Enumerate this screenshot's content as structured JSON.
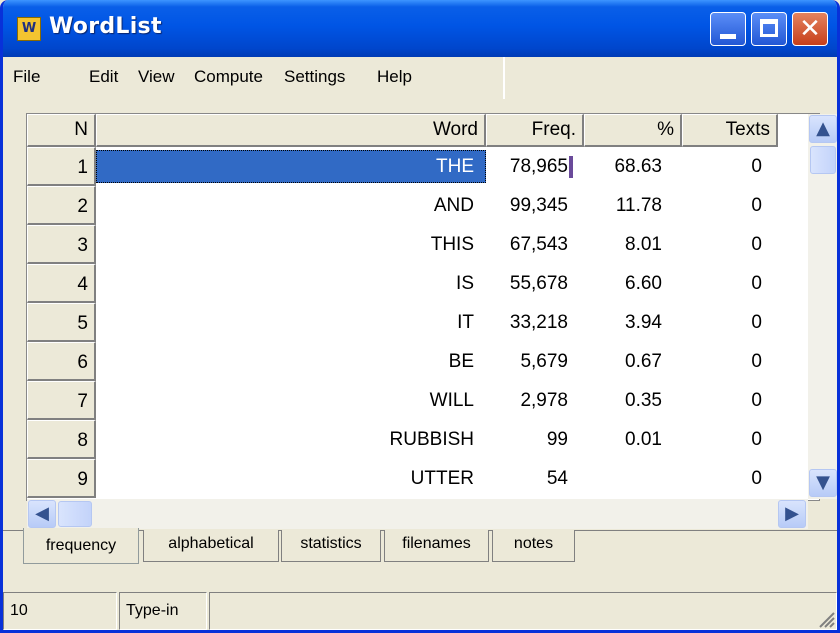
{
  "window": {
    "title": "WordList",
    "icon": "wordlist-app-icon",
    "accent": "#0055e5"
  },
  "menu": [
    "File",
    "Edit",
    "View",
    "Compute",
    "Settings",
    "Help"
  ],
  "table": {
    "columns": [
      "N",
      "Word",
      "Freq.",
      "%",
      "Texts"
    ],
    "rows": [
      {
        "n": "1",
        "word": "THE",
        "freq": "78,965",
        "pct": "68.63",
        "texts": "0",
        "selected": true
      },
      {
        "n": "2",
        "word": "AND",
        "freq": "99,345",
        "pct": "11.78",
        "texts": "0"
      },
      {
        "n": "3",
        "word": "THIS",
        "freq": "67,543",
        "pct": "8.01",
        "texts": "0"
      },
      {
        "n": "4",
        "word": "IS",
        "freq": "55,678",
        "pct": "6.60",
        "texts": "0"
      },
      {
        "n": "5",
        "word": "IT",
        "freq": "33,218",
        "pct": "3.94",
        "texts": "0"
      },
      {
        "n": "6",
        "word": "BE",
        "freq": "5,679",
        "pct": "0.67",
        "texts": "0"
      },
      {
        "n": "7",
        "word": "WILL",
        "freq": "2,978",
        "pct": "0.35",
        "texts": "0"
      },
      {
        "n": "8",
        "word": "RUBBISH",
        "freq": "99",
        "pct": "0.01",
        "texts": "0"
      },
      {
        "n": "9",
        "word": "UTTER",
        "freq": "54",
        "pct": "",
        "texts": "0"
      }
    ],
    "selection_color": "#316ac5"
  },
  "tabs": [
    "frequency",
    "alphabetical",
    "statistics",
    "filenames",
    "notes"
  ],
  "active_tab": "frequency",
  "status": {
    "count": "10",
    "mode": "Type-in"
  }
}
